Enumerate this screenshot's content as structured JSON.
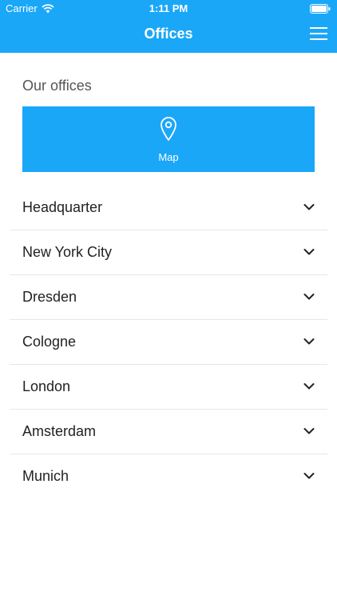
{
  "status_bar": {
    "carrier": "Carrier",
    "time": "1:11 PM"
  },
  "nav": {
    "title": "Offices",
    "menu_icon": "hamburger-menu-icon"
  },
  "section": {
    "title": "Our offices"
  },
  "map_button": {
    "label": "Map",
    "icon": "map-pin-icon"
  },
  "offices": [
    {
      "name": "Headquarter"
    },
    {
      "name": "New York City"
    },
    {
      "name": "Dresden"
    },
    {
      "name": "Cologne"
    },
    {
      "name": "London"
    },
    {
      "name": "Amsterdam"
    },
    {
      "name": "Munich"
    }
  ],
  "colors": {
    "accent": "#1aa7f8",
    "text": "#222222",
    "muted": "#555555",
    "divider": "#e6e6e6"
  }
}
